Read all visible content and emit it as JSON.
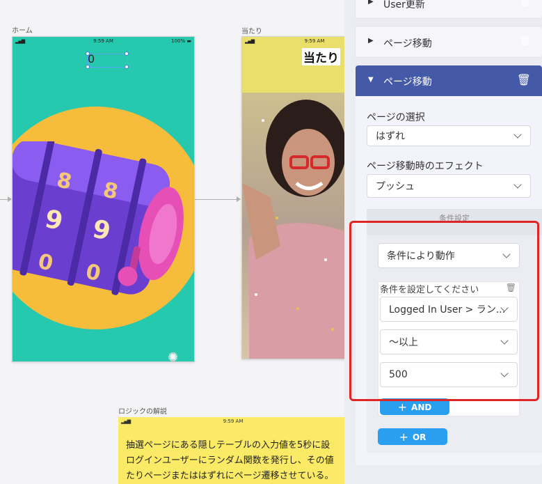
{
  "canvas": {
    "frames": {
      "home_label": "ホーム",
      "hit_label": "当たり",
      "logic_label": "ロジックの解説"
    },
    "home_phone": {
      "status_time": "9:59 AM",
      "status_battery": "100%",
      "counter": "0",
      "background_color": "#26c9ad",
      "circle_color": "#f6bd3d"
    },
    "hit_phone": {
      "status_time": "9:59 AM",
      "title": "当たり",
      "background_color": "#eadf6b"
    },
    "logic_note": {
      "status_time": "9:59 AM",
      "lines": [
        "抽選ページにある隠しテーブルの入力値を5秒に設",
        "ログインユーザーにランダム関数を発行し、その値",
        "たりページまたははずれにページ遷移させている。"
      ],
      "background_color": "#faea65"
    }
  },
  "panel": {
    "collapsed": [
      {
        "title": "User更新"
      },
      {
        "title": "ページ移動"
      }
    ],
    "active": {
      "title": "ページ移動",
      "header_color": "#4459a8",
      "page_select_label": "ページの選択",
      "page_select_value": "はずれ",
      "effect_label": "ページ移動時のエフェクト",
      "effect_value": "プッシュ",
      "condition_section_title": "条件設定",
      "condition_mode_value": "条件により動作",
      "condition_box_label": "条件を設定してください",
      "condition_field_value": "Logged In User > ラン...",
      "condition_operator_value": "〜以上",
      "condition_number_value": "500",
      "and_button": "AND",
      "or_button": "OR",
      "button_color": "#2a9ff0"
    }
  },
  "highlight_color": "#e02525"
}
